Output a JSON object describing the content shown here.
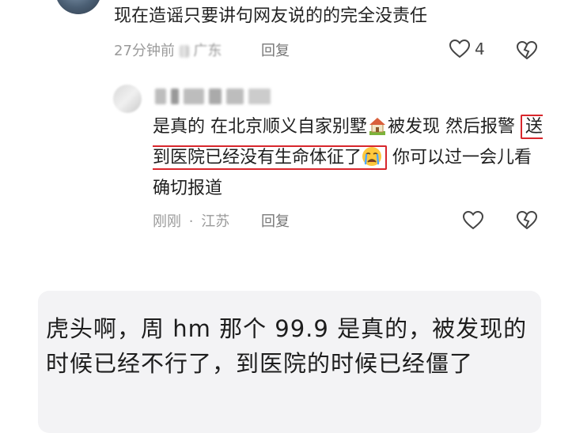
{
  "top_comment": {
    "text": "现在造谣只要讲句网友说的的完全没责任",
    "time": "27分钟前",
    "location": "广东",
    "reply_label": "回复",
    "like_count": "4"
  },
  "reply": {
    "text_before": "是真的 在北京顺义自家别墅",
    "text_after_house": "被发现 然后报警",
    "highlighted_text": "送到医院已经没有生命体征了",
    "text_end": "你可以过一会儿看确切报道",
    "time": "刚刚",
    "location": "江苏",
    "reply_label": "回复"
  },
  "quoted_card": {
    "text": "虎头啊，周 hm 那个 99.9 是真的，被发现的时候已经不行了，到医院的时候已经僵了"
  },
  "colors": {
    "highlight_border": "#d8262c",
    "meta_text": "#9a9a9a"
  },
  "icons": [
    "heart-icon",
    "dislike-heart-icon",
    "house-emoji",
    "crying-emoji"
  ]
}
